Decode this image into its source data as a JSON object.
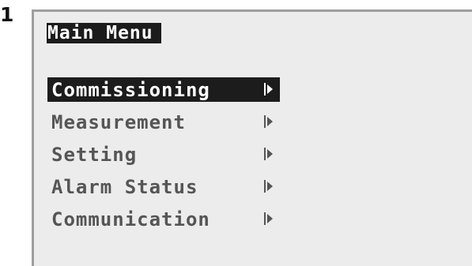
{
  "figure_number": "1",
  "screen": {
    "title": "Main Menu",
    "menu_items": [
      {
        "label": "Commissioning",
        "selected": true,
        "icon": "right-arrow-icon"
      },
      {
        "label": "Measurement",
        "selected": false,
        "icon": "right-arrow-icon"
      },
      {
        "label": "Setting",
        "selected": false,
        "icon": "right-arrow-icon"
      },
      {
        "label": "Alarm Status",
        "selected": false,
        "icon": "right-arrow-icon"
      },
      {
        "label": "Communication",
        "selected": false,
        "icon": "right-arrow-icon"
      }
    ]
  },
  "colors": {
    "screen_background": "#ececec",
    "highlight_background": "#1c1c1c",
    "highlight_text": "#ffffff",
    "item_text": "#555555",
    "frame_border": "#9e9e9e"
  }
}
